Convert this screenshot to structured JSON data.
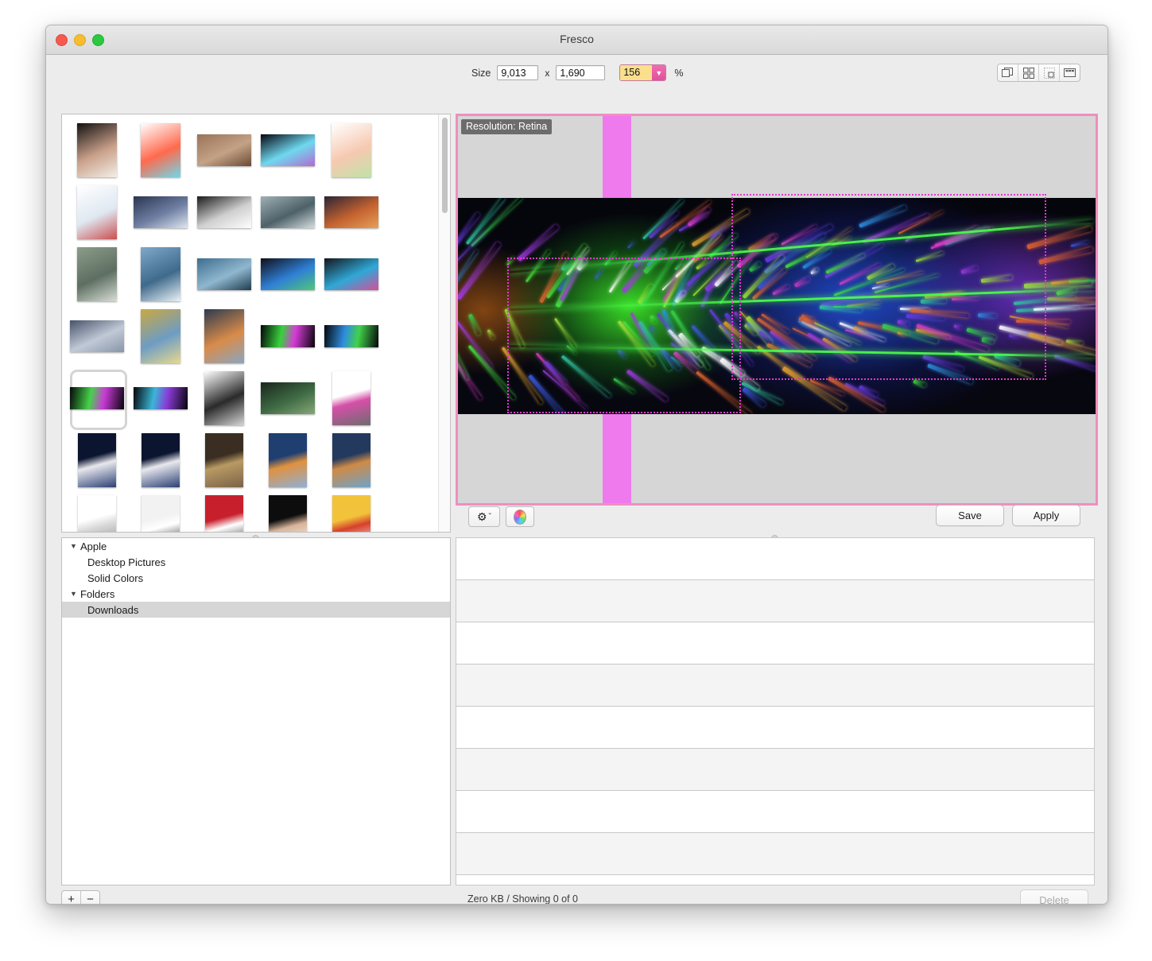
{
  "window": {
    "title": "Fresco",
    "controls": {
      "close": "close",
      "minimize": "minimize",
      "zoom": "zoom"
    }
  },
  "toolbar": {
    "size_label": "Size",
    "width_value": "9,013",
    "separator": "x",
    "height_value": "1,690",
    "zoom_value": "156",
    "zoom_arrow": "▼",
    "percent_label": "%",
    "view_modes": [
      {
        "name": "single-view",
        "label": "Single"
      },
      {
        "name": "grid-view",
        "label": "Grid"
      },
      {
        "name": "sprite-view",
        "label": "Sprite"
      },
      {
        "name": "filmstrip-view",
        "label": "Filmstrip"
      }
    ]
  },
  "preview": {
    "resolution_badge": "Resolution: Retina",
    "border_color": "#ef8ec0",
    "band_color": "#ee7aee",
    "guide_color": "#e23ad0",
    "canvas_color": "#d6d6d6"
  },
  "actions": {
    "gear_label": "⚙",
    "gear_chevron": "ˇ",
    "color_wheel_label": "color-wheel",
    "save_label": "Save",
    "apply_label": "Apply"
  },
  "sidebar": {
    "items": [
      {
        "label": "Apple",
        "level": "group",
        "expanded": true,
        "selected": false
      },
      {
        "label": "Desktop Pictures",
        "level": "child",
        "selected": false
      },
      {
        "label": "Solid Colors",
        "level": "child",
        "selected": false
      },
      {
        "label": "Folders",
        "level": "group",
        "expanded": true,
        "selected": false
      },
      {
        "label": "Downloads",
        "level": "child",
        "selected": true
      }
    ],
    "disclosure_glyph": "▼"
  },
  "file_list": {
    "rows": [
      "",
      "",
      "",
      "",
      "",
      "",
      "",
      ""
    ]
  },
  "bottom_bar": {
    "add_label": "+",
    "remove_label": "−",
    "status": "Zero KB / Showing 0 of 0",
    "delete_label": "Delete"
  },
  "thumbnails": {
    "rows": [
      [
        {
          "name": "girl-with-sword-artwork",
          "shape": "tall",
          "palette": [
            "#111111",
            "#caa08a",
            "#f2efe8"
          ]
        },
        {
          "name": "common-adjectives-chart",
          "shape": "tall",
          "palette": [
            "#ffffff",
            "#ff6a4d",
            "#6fd8e8"
          ]
        },
        {
          "name": "brick-wall-photo",
          "shape": "mid",
          "palette": [
            "#9a7358",
            "#c3a286",
            "#6a4a33"
          ]
        },
        {
          "name": "abstract-aurora-dark",
          "shape": "mid",
          "palette": [
            "#060610",
            "#6fd8ef",
            "#b36ad1"
          ]
        },
        {
          "name": "common-proper-noun-chart",
          "shape": "tall",
          "palette": [
            "#ffffff",
            "#f6c9b0",
            "#bfe3a8"
          ]
        },
        {
          "name": "list-of-adjectives-chart",
          "shape": "tall",
          "palette": [
            "#ffffff",
            "#dfe8f2",
            "#c94f4f"
          ]
        }
      ],
      [
        {
          "name": "city-skyline-dusk",
          "shape": "mid",
          "palette": [
            "#2b3550",
            "#6f7fa3",
            "#dfe6f0"
          ]
        },
        {
          "name": "anime-monochrome-poster",
          "shape": "mid",
          "palette": [
            "#1a1a1a",
            "#cfcfcf",
            "#ffffff"
          ]
        },
        {
          "name": "foggy-lake-forest",
          "shape": "mid",
          "palette": [
            "#9fb0b5",
            "#4d6168",
            "#d6dee0"
          ]
        },
        {
          "name": "mountain-sunset-peaks",
          "shape": "mid",
          "palette": [
            "#2a2437",
            "#c4622f",
            "#e7a05a"
          ]
        },
        {
          "name": "hiking-trail-mountains",
          "shape": "tall",
          "palette": [
            "#8d9c8a",
            "#5d6f62",
            "#d8ddd5"
          ]
        },
        {
          "name": "snow-mountain-valley",
          "shape": "tall",
          "palette": [
            "#7fa8c9",
            "#3f6a8c",
            "#eaf2f7"
          ]
        }
      ],
      [
        {
          "name": "blue-lake-mountain",
          "shape": "mid",
          "palette": [
            "#3e6d8e",
            "#8fb7cf",
            "#1f3b4d"
          ]
        },
        {
          "name": "rgb-desk-setup-a",
          "shape": "mid",
          "palette": [
            "#101018",
            "#2f7fd6",
            "#50c878"
          ]
        },
        {
          "name": "rgb-desk-setup-b",
          "shape": "mid",
          "palette": [
            "#15151d",
            "#2fa8d6",
            "#d64f9a"
          ]
        },
        {
          "name": "cloudy-sunrise-valley",
          "shape": "mid",
          "palette": [
            "#46536b",
            "#c1c9d6",
            "#8795a8"
          ]
        },
        {
          "name": "rainbow-field-photo",
          "shape": "tall",
          "palette": [
            "#caa93f",
            "#6e9cc4",
            "#e6d98f"
          ]
        },
        {
          "name": "mountain-dawn-lake",
          "shape": "tall",
          "palette": [
            "#2c3a4f",
            "#d98b4a",
            "#8aa6bf"
          ]
        }
      ],
      [
        {
          "name": "razer-rainbow-wave-a",
          "shape": "wide",
          "palette": [
            "#050509",
            "#37d23b",
            "#d63ad6"
          ]
        },
        {
          "name": "razer-rainbow-wave-b",
          "shape": "wide",
          "palette": [
            "#050509",
            "#2f8ee0",
            "#41d14a"
          ]
        },
        {
          "name": "razer-rainbow-wave-selected",
          "shape": "wide",
          "selected": true,
          "palette": [
            "#050509",
            "#46d24a",
            "#c93ad6"
          ]
        },
        {
          "name": "razer-rainbow-wave-c",
          "shape": "wide",
          "palette": [
            "#050509",
            "#3ab7d6",
            "#8a3ad6"
          ]
        },
        {
          "name": "anime-lineart-portrait",
          "shape": "tall",
          "palette": [
            "#ffffff",
            "#2a2a2a",
            "#d6d6d6"
          ]
        },
        {
          "name": "forest-path-dark",
          "shape": "mid",
          "palette": [
            "#18261c",
            "#3f6b44",
            "#86a878"
          ]
        }
      ],
      [
        {
          "name": "think-python-book",
          "shape": "book",
          "palette": [
            "#ffffff",
            "#d64fa8",
            "#6d6d6d"
          ]
        },
        {
          "name": "edgedancer-book-a",
          "shape": "book",
          "palette": [
            "#0b1530",
            "#e8e8ee",
            "#2a3f73"
          ]
        },
        {
          "name": "edgedancer-book-b",
          "shape": "book",
          "palette": [
            "#0b1530",
            "#e8e8ee",
            "#2a3f73"
          ]
        },
        {
          "name": "oathbringer-book",
          "shape": "book",
          "palette": [
            "#3a2d22",
            "#b99a63",
            "#7a6248"
          ]
        },
        {
          "name": "way-of-kings-book",
          "shape": "book",
          "palette": [
            "#1f3f70",
            "#e0913f",
            "#8fb0d6"
          ]
        },
        {
          "name": "words-of-radiance-book",
          "shape": "book",
          "palette": [
            "#233a5e",
            "#cf8a45",
            "#6fa3c9"
          ]
        }
      ],
      [
        {
          "name": "the-one-device-book",
          "shape": "book",
          "palette": [
            "#ffffff",
            "#d8d8d8",
            "#8a8a8a"
          ]
        },
        {
          "name": "document-preview-page",
          "shape": "book",
          "palette": [
            "#f2f2f2",
            "#ffffff",
            "#111111"
          ]
        },
        {
          "name": "i-heard-you-paint-houses-book",
          "shape": "book",
          "palette": [
            "#c7202c",
            "#ffffff",
            "#1a1a1a"
          ]
        },
        {
          "name": "sex-at-dawn-book",
          "shape": "book",
          "palette": [
            "#0d0d0d",
            "#d8b49a",
            "#ffffff"
          ]
        },
        {
          "name": "how-to-win-friends-book",
          "shape": "book",
          "palette": [
            "#f2c33a",
            "#d6402c",
            "#ffffff"
          ]
        },
        {
          "name": "hitchhikers-guide-book",
          "shape": "book",
          "palette": [
            "#0f1d3d",
            "#e8e8e8",
            "#3fa83f"
          ]
        }
      ],
      [
        {
          "name": "killing-commendatore-book",
          "shape": "book",
          "palette": [
            "#8fb8c4",
            "#2e4b57",
            "#e4ece8"
          ]
        },
        {
          "name": "the-gods-themselves-book",
          "shape": "book",
          "palette": [
            "#0a0a14",
            "#d62c2c",
            "#e8c45a"
          ]
        },
        {
          "name": "catcher-in-the-rye-book",
          "shape": "book",
          "palette": [
            "#e8432a",
            "#ffffff",
            "#c4301c"
          ]
        },
        {
          "name": "quick-start-guide-book",
          "shape": "book",
          "palette": [
            "#ffffff",
            "#6b4a2a",
            "#3f7fc4"
          ]
        },
        {
          "name": "the-righteous-mind-book",
          "shape": "book",
          "palette": [
            "#ffffff",
            "#3a3a3a",
            "#c4a24a"
          ]
        },
        {
          "name": "subtle-art-book",
          "shape": "book",
          "palette": [
            "#f0562a",
            "#ffffff",
            "#d6421c"
          ]
        }
      ]
    ]
  }
}
